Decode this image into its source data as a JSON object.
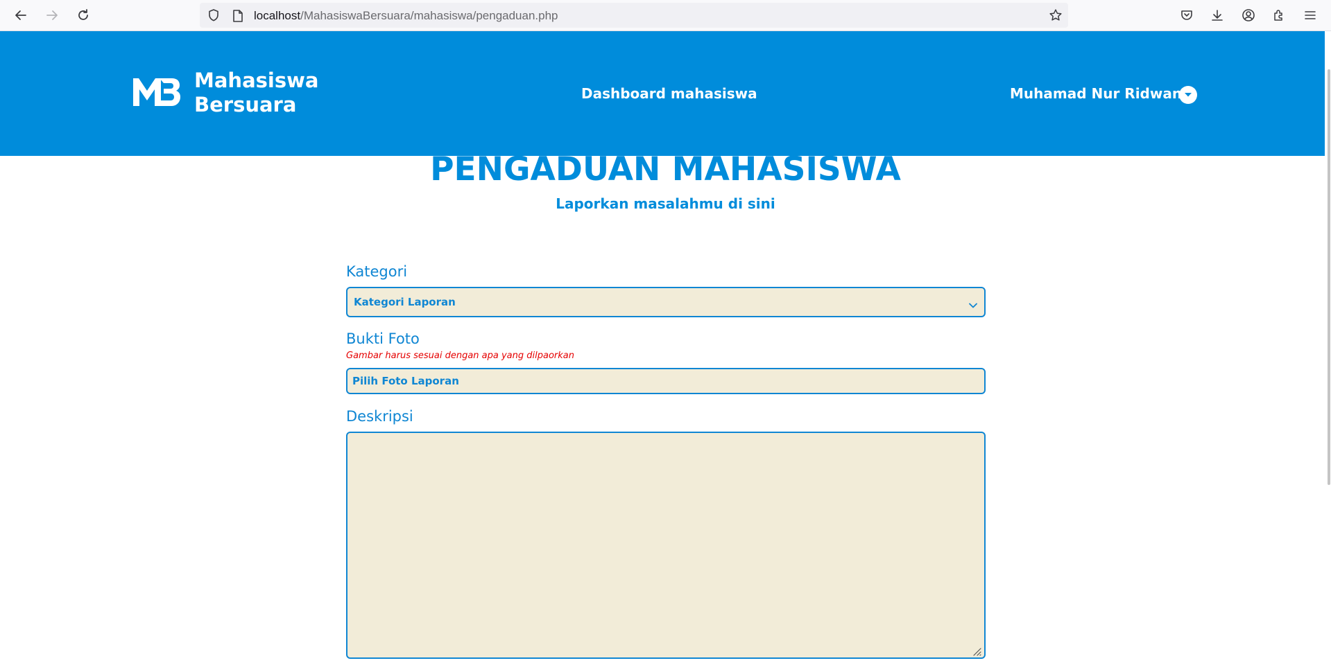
{
  "browser": {
    "url_host": "localhost",
    "url_path": "/MahasiswaBersuara/mahasiswa/pengaduan.php",
    "icons": [
      "back-arrow-icon",
      "forward-arrow-icon",
      "reload-icon",
      "shield-icon",
      "page-icon",
      "bookmark-star-icon",
      "pocket-icon",
      "download-icon",
      "account-icon",
      "extensions-icon",
      "menu-icon"
    ]
  },
  "header": {
    "logo_mark": "MB",
    "brand_line1": "Mahasiswa",
    "brand_line2": "Bersuara",
    "nav_dashboard": "Dashboard mahasiswa",
    "user_name": "Muhamad Nur Ridwan",
    "background_color": "#008cdb"
  },
  "main": {
    "title": "PENGADUAN MAHASISWA",
    "subtitle": "Laporkan masalahmu di sini",
    "accent_color": "#0f86d3",
    "field_bg_color": "#f2ecd8"
  },
  "form": {
    "kategori_label": "Kategori",
    "kategori_selected": "Kategori Laporan",
    "bukti_label": "Bukti Foto",
    "bukti_hint": "Gambar harus sesuai dengan apa yang dilpaorkan",
    "bukti_placeholder": "Pilih Foto Laporan",
    "deskripsi_label": "Deskripsi",
    "deskripsi_value": "",
    "hint_color": "#e50000"
  }
}
